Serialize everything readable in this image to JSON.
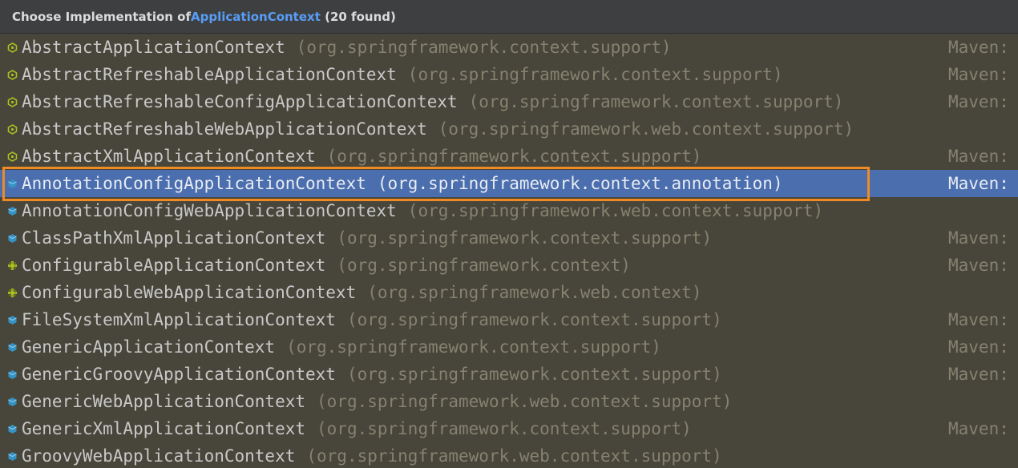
{
  "header": {
    "prefix": "Choose Implementation of ",
    "interface": "ApplicationContext",
    "count": "(20 found)"
  },
  "colors": {
    "selection": "#4b6eaf",
    "highlight_border": "#f08a24",
    "interface_link": "#589df6",
    "abstract_icon": "#a8c023",
    "class_icon": "#3592c4",
    "interface_icon": "#a8c023"
  },
  "rows": [
    {
      "name": "AbstractApplicationContext",
      "pkg": "(org.springframework.context.support)",
      "maven": "Maven:",
      "icon": "abstract-class-icon"
    },
    {
      "name": "AbstractRefreshableApplicationContext",
      "pkg": "(org.springframework.context.support)",
      "maven": "Maven:",
      "icon": "abstract-class-icon"
    },
    {
      "name": "AbstractRefreshableConfigApplicationContext",
      "pkg": "(org.springframework.context.support)",
      "maven": "Maven:",
      "icon": "abstract-class-icon"
    },
    {
      "name": "AbstractRefreshableWebApplicationContext",
      "pkg": "(org.springframework.web.context.support)",
      "maven": "",
      "icon": "abstract-class-icon"
    },
    {
      "name": "AbstractXmlApplicationContext",
      "pkg": "(org.springframework.context.support)",
      "maven": "Maven:",
      "icon": "abstract-class-icon"
    },
    {
      "name": "AnnotationConfigApplicationContext",
      "pkg": "(org.springframework.context.annotation)",
      "maven": "Maven: org.s",
      "icon": "class-icon",
      "selected": true
    },
    {
      "name": "AnnotationConfigWebApplicationContext",
      "pkg": "(org.springframework.web.context.support)",
      "maven": "",
      "icon": "class-icon"
    },
    {
      "name": "ClassPathXmlApplicationContext",
      "pkg": "(org.springframework.context.support)",
      "maven": "Maven:",
      "icon": "class-icon"
    },
    {
      "name": "ConfigurableApplicationContext",
      "pkg": "(org.springframework.context)",
      "maven": "Maven:",
      "icon": "interface-icon"
    },
    {
      "name": "ConfigurableWebApplicationContext",
      "pkg": "(org.springframework.web.context)",
      "maven": "",
      "icon": "interface-icon"
    },
    {
      "name": "FileSystemXmlApplicationContext",
      "pkg": "(org.springframework.context.support)",
      "maven": "Maven:",
      "icon": "class-icon"
    },
    {
      "name": "GenericApplicationContext",
      "pkg": "(org.springframework.context.support)",
      "maven": "Maven:",
      "icon": "class-icon"
    },
    {
      "name": "GenericGroovyApplicationContext",
      "pkg": "(org.springframework.context.support)",
      "maven": "Maven:",
      "icon": "class-icon"
    },
    {
      "name": "GenericWebApplicationContext",
      "pkg": "(org.springframework.web.context.support)",
      "maven": "",
      "icon": "class-icon"
    },
    {
      "name": "GenericXmlApplicationContext",
      "pkg": "(org.springframework.context.support)",
      "maven": "Maven:",
      "icon": "class-icon"
    },
    {
      "name": "GroovyWebApplicationContext",
      "pkg": "(org.springframework.web.context.support)",
      "maven": "",
      "icon": "class-icon"
    }
  ]
}
